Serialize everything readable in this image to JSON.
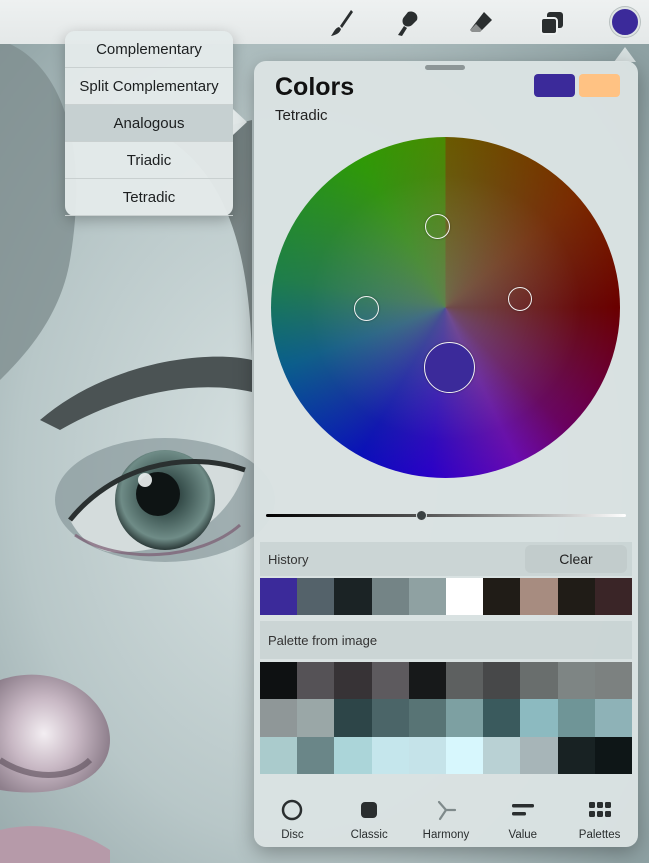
{
  "toolbar": {
    "tools": [
      {
        "name": "brush",
        "icon": "brush-icon"
      },
      {
        "name": "smudge",
        "icon": "smudge-icon"
      },
      {
        "name": "eraser",
        "icon": "eraser-icon"
      },
      {
        "name": "layers",
        "icon": "layers-icon"
      }
    ],
    "current_color": "#3b2a9a"
  },
  "harmony_menu": {
    "items": [
      "Complementary",
      "Split Complementary",
      "Analogous",
      "Triadic",
      "Tetradic"
    ],
    "highlighted": "Analogous"
  },
  "colors_panel": {
    "title": "Colors",
    "mode": "Tetradic",
    "primary_color": "#3b2a9a",
    "secondary_color": "#ffc283",
    "brightness": 0.43,
    "history": {
      "label": "History",
      "clear_label": "Clear",
      "swatches": [
        "#3b2a9a",
        "#54626a",
        "#1b2325",
        "#748486",
        "#8fa1a2",
        "#ffffff",
        "#201c17",
        "#a78c80",
        "#201c17",
        "#3a2527"
      ]
    },
    "palette": {
      "label": "Palette from image",
      "swatches": [
        "#0e1112",
        "#555256",
        "#373336",
        "#5d5a5e",
        "#17191a",
        "#5d6060",
        "#474849",
        "#696e6d",
        "#7e8584",
        "#7c8180",
        "#8f9798",
        "#9aa7a7",
        "#2d4548",
        "#4b6568",
        "#587475",
        "#7da0a2",
        "#3a5a5d",
        "#8cbac0",
        "#6f9597",
        "#8eb2b7",
        "#aacbcc",
        "#6a8688",
        "#abd5d9",
        "#c5e6ec",
        "#c5e3e9",
        "#d7f7fd",
        "#b9d1d4",
        "#a7b5b8",
        "#182223",
        "#0e1617"
      ]
    },
    "tabs": [
      {
        "label": "Disc",
        "icon": "disc-icon"
      },
      {
        "label": "Classic",
        "icon": "classic-icon"
      },
      {
        "label": "Harmony",
        "icon": "harmony-icon"
      },
      {
        "label": "Value",
        "icon": "value-icon"
      },
      {
        "label": "Palettes",
        "icon": "palettes-icon"
      }
    ]
  }
}
